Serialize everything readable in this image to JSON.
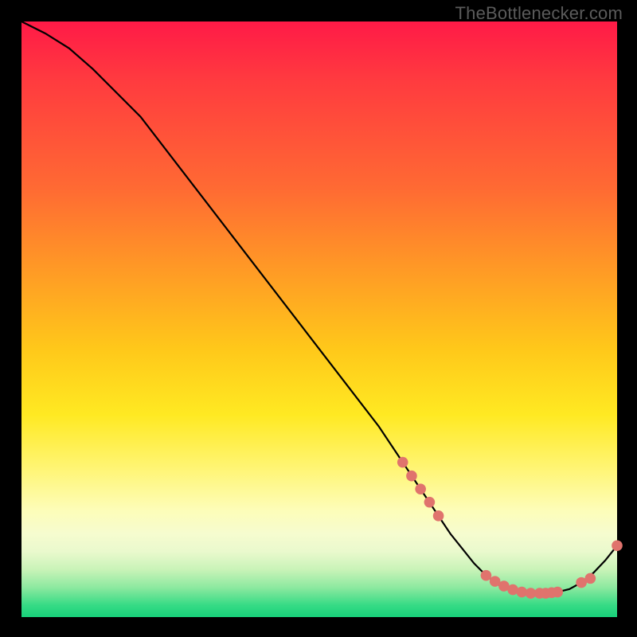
{
  "attribution": "TheBottlenecker.com",
  "chart_data": {
    "type": "line",
    "title": "",
    "xlabel": "",
    "ylabel": "",
    "xlim": [
      0,
      100
    ],
    "ylim": [
      0,
      100
    ],
    "series": [
      {
        "name": "curve",
        "x": [
          0,
          4,
          8,
          12,
          20,
          30,
          40,
          50,
          60,
          64,
          66,
          68,
          70,
          72,
          74,
          76,
          78,
          80,
          82,
          84,
          86,
          88,
          90,
          92,
          94,
          96,
          98,
          100
        ],
        "y": [
          100,
          98,
          95.5,
          92,
          84,
          71,
          58,
          45,
          32,
          26,
          23,
          20,
          17,
          14,
          11.5,
          9,
          7,
          5.5,
          4.5,
          4,
          4,
          4,
          4.2,
          4.7,
          5.8,
          7.4,
          9.5,
          12
        ]
      }
    ],
    "markers": {
      "name": "highlight-points",
      "x": [
        64,
        65.5,
        67,
        68.5,
        70,
        78,
        79.5,
        81,
        82.5,
        84,
        85.5,
        87,
        88,
        89,
        90,
        94,
        95.5,
        100
      ],
      "y": [
        26,
        23.7,
        21.5,
        19.3,
        17,
        7,
        6,
        5.2,
        4.6,
        4.2,
        4,
        4,
        4,
        4.1,
        4.2,
        5.8,
        6.5,
        12
      ]
    },
    "marker_radius": 6.8,
    "colors": {
      "curve": "#000000",
      "marker": "#e0736d"
    }
  }
}
